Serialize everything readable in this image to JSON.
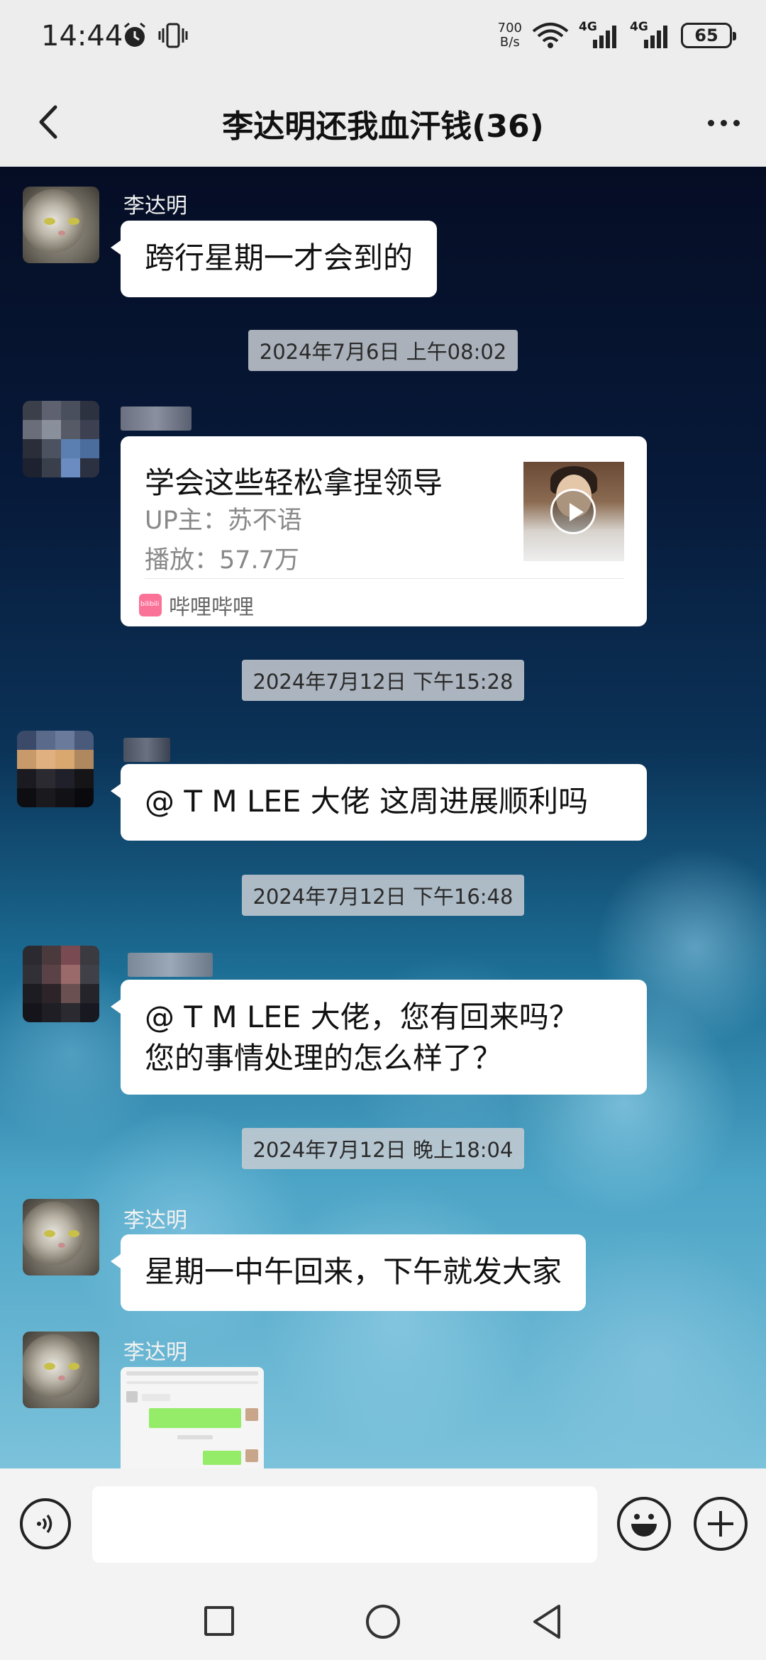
{
  "status_bar": {
    "time": "14:44",
    "net_speed_value": "700",
    "net_speed_unit": "B/s",
    "signal_1_label": "4G",
    "signal_2_label": "4G",
    "battery": "65"
  },
  "header": {
    "title": "李达明还我血汗钱(36)"
  },
  "messages": [
    {
      "sender": "李达明",
      "text": "跨行星期一才会到的"
    },
    {
      "timestamp": "2024年7月6日 上午08:02"
    },
    {
      "card": {
        "title": "学会这些轻松拿捏领导",
        "up": "UP主：苏不语",
        "plays": "播放：57.7万",
        "source": "哔哩哔哩"
      }
    },
    {
      "timestamp": "2024年7月12日 下午15:28"
    },
    {
      "text": "@  T M LEE  大佬 这周进展顺利吗"
    },
    {
      "timestamp": "2024年7月12日 下午16:48"
    },
    {
      "text_line1": "@  T M LEE  大佬，您有回来吗？",
      "text_line2": "您的事情处理的怎么样了？"
    },
    {
      "timestamp": "2024年7月12日 晚上18:04"
    },
    {
      "sender": "李达明",
      "text": "星期一中午回来，下午就发大家"
    },
    {
      "sender": "李达明",
      "image": "screenshot"
    }
  ],
  "input_bar": {
    "placeholder": ""
  },
  "icons": {
    "back": "chevron-left-icon",
    "more": "more-dots-icon",
    "voice": "voice-icon",
    "emoji": "emoji-icon",
    "plus": "plus-icon"
  }
}
